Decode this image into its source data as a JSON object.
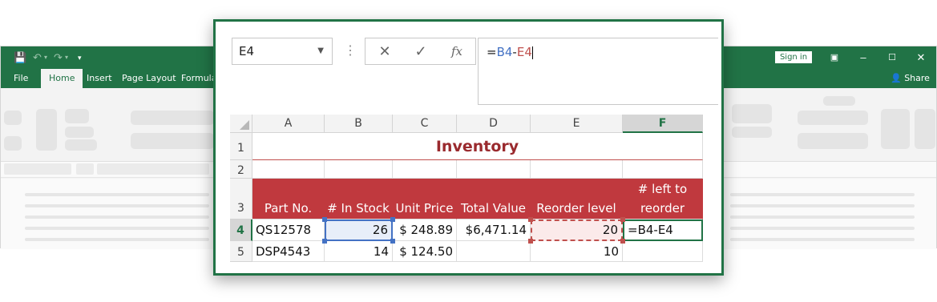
{
  "window": {
    "tabs": [
      "File",
      "Home",
      "Insert",
      "Page Layout",
      "Formulas"
    ],
    "active_tab": "Home",
    "signin_label": "Sign in",
    "share_label": "Share",
    "accent_color": "#217346"
  },
  "formula_bar": {
    "name_box": "E4",
    "formula_prefix": "=",
    "ref1": "B4",
    "operator": "-",
    "ref2": "E4",
    "cancel_icon": "close-icon",
    "enter_icon": "check-icon",
    "fx_label": "fx"
  },
  "sheet": {
    "columns": [
      "A",
      "B",
      "C",
      "D",
      "E",
      "F"
    ],
    "selected_column": "F",
    "rows": [
      "1",
      "2",
      "3",
      "4",
      "5"
    ],
    "selected_row": "4",
    "title": "Inventory",
    "headers": {
      "a": "Part No.",
      "b": "# In Stock",
      "c": "Unit Price",
      "d": "Total Value",
      "e": "Reorder level",
      "f": "# left to reorder"
    },
    "row4": {
      "a": "QS12578",
      "b": "26",
      "c": "$ 248.89",
      "d": "$6,471.14",
      "e": "20",
      "f": "=B4-E4"
    },
    "row5": {
      "a": "DSP4543",
      "b": "14",
      "c": "$ 124.50",
      "d": "",
      "e": "10",
      "f": ""
    },
    "header_color": "#c0393e",
    "title_color": "#9a2a2e"
  }
}
